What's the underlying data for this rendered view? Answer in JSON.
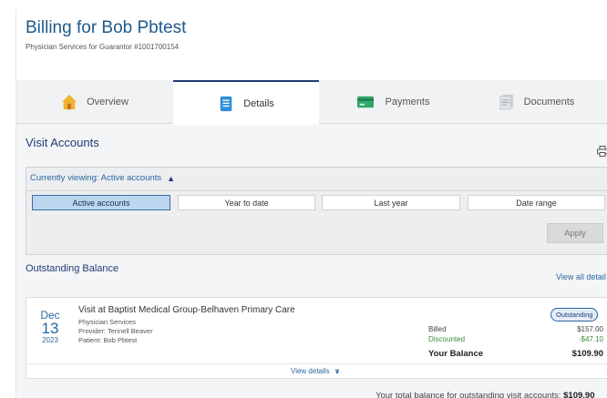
{
  "header": {
    "title": "Billing for Bob Pbtest",
    "subtitle": "Physician Services for Guarantor #1001700154"
  },
  "tabs": [
    {
      "label": "Overview",
      "icon": "home-icon",
      "active": false
    },
    {
      "label": "Details",
      "icon": "document-icon",
      "active": true
    },
    {
      "label": "Payments",
      "icon": "credit-card-icon",
      "active": false
    },
    {
      "label": "Documents",
      "icon": "documents-icon",
      "active": false
    }
  ],
  "visit_accounts": {
    "title": "Visit Accounts",
    "currently_viewing": "Currently viewing: Active accounts",
    "filters": [
      {
        "label": "Active accounts",
        "active": true
      },
      {
        "label": "Year to date",
        "active": false
      },
      {
        "label": "Last year",
        "active": false
      },
      {
        "label": "Date range",
        "active": false
      }
    ],
    "apply_label": "Apply"
  },
  "outstanding": {
    "title": "Outstanding Balance",
    "view_all_label": "View all detail",
    "visit": {
      "month": "Dec",
      "day": "13",
      "year": "2023",
      "title": "Visit at Baptist Medical Group-Belhaven Primary Care",
      "service": "Physician Services",
      "provider": "Provider: Terinell Beaver",
      "patient": "Patient: Bob Pbtest",
      "status": "Outstanding",
      "billed_label": "Billed",
      "billed_amount": "$157.00",
      "discounted_label": "Discounted",
      "discounted_amount": "-$47.10",
      "balance_label": "Your Balance",
      "balance_amount": "$109.90",
      "view_details_label": "View details"
    },
    "total_label": "Your total balance for outstanding visit accounts:",
    "total_amount": "$109.90"
  },
  "colors": {
    "brand": "#1f3b73",
    "link": "#2a66a0",
    "discount": "#3a8a3a",
    "active_filter": "#bcd6ef"
  }
}
